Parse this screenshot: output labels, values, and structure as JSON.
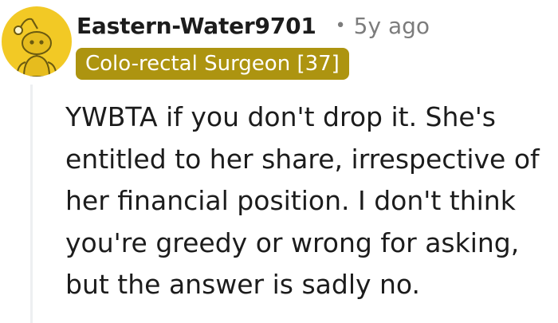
{
  "comment": {
    "avatar_icon": "reddit-snoo-avatar-icon",
    "avatar_color": "#f2c925",
    "username": "Eastern-Water9701",
    "separator": "•",
    "timestamp": "5y ago",
    "flair": {
      "text": "Colo-rectal Surgeon [37]",
      "background": "#ad9410"
    },
    "body": "YWBTA if you don't drop it. She's entitled to her share, irrespective of her financial position. I don't think you're greedy or wrong for asking, but the answer is sadly no."
  }
}
